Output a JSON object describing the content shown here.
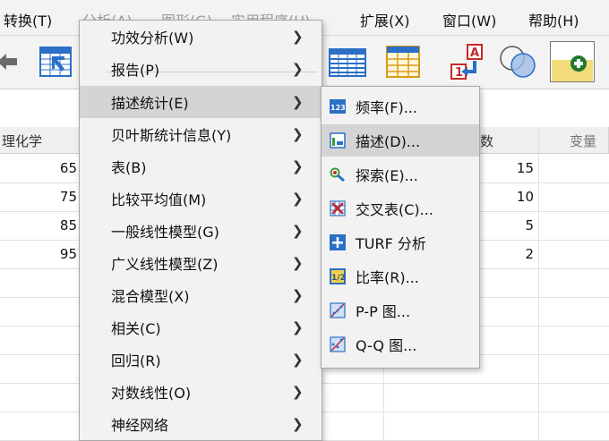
{
  "menubar": {
    "items": [
      "转换(T)",
      "分析(A)",
      "图形(G)",
      "实用程序(U)",
      "扩展(X)",
      "窗口(W)",
      "帮助(H)"
    ]
  },
  "grid": {
    "headers": [
      "理化学",
      "",
      "数",
      "变量"
    ],
    "col1_values": [
      "65",
      "75",
      "85",
      "95"
    ],
    "col3_values": [
      "15",
      "10",
      "5",
      "2"
    ]
  },
  "analyze_menu": {
    "items": [
      {
        "label": "功效分析(W)"
      },
      {
        "label": "报告(P)"
      },
      {
        "label": "描述统计(E)"
      },
      {
        "label": "贝叶斯统计信息(Y)"
      },
      {
        "label": "表(B)"
      },
      {
        "label": "比较平均值(M)"
      },
      {
        "label": "一般线性模型(G)"
      },
      {
        "label": "广义线性模型(Z)"
      },
      {
        "label": "混合模型(X)"
      },
      {
        "label": "相关(C)"
      },
      {
        "label": "回归(R)"
      },
      {
        "label": "对数线性(O)"
      },
      {
        "label": "神经网络"
      }
    ],
    "highlighted_index": 2
  },
  "descriptive_submenu": {
    "items": [
      {
        "label": "频率(F)...",
        "icon": "frequency-123-icon"
      },
      {
        "label": "描述(D)...",
        "icon": "descriptives-icon"
      },
      {
        "label": "探索(E)...",
        "icon": "explore-icon"
      },
      {
        "label": "交叉表(C)...",
        "icon": "crosstabs-icon"
      },
      {
        "label": "TURF 分析",
        "icon": "turf-plus-icon"
      },
      {
        "label": "比率(R)...",
        "icon": "ratio-half-icon"
      },
      {
        "label": "P-P 图...",
        "icon": "pp-plot-icon"
      },
      {
        "label": "Q-Q 图...",
        "icon": "qq-plot-icon"
      }
    ],
    "highlighted_index": 1
  },
  "colors": {
    "menu_bg": "#f2f2f2",
    "highlight": "#d4d4d4",
    "accent_blue": "#2b6fc7"
  }
}
